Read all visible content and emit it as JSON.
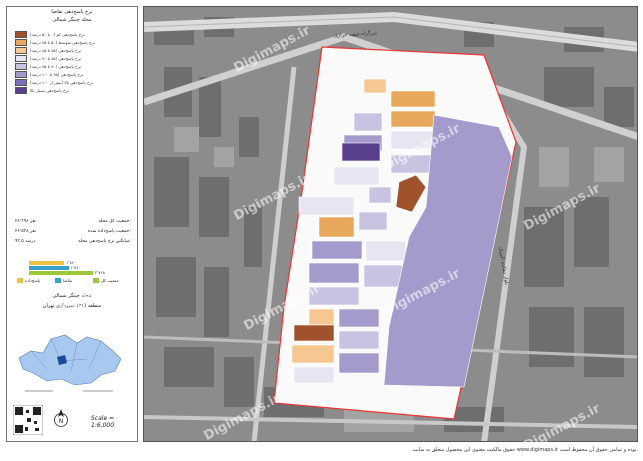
{
  "legend": {
    "title": "نرخ پاسخ‌دهی تقاضا",
    "subtitle": "محله چیتگر شمالی",
    "items": [
      {
        "label": "نرخ پاسخ‌دهی کم (۰ تا ۵۰ درصد)",
        "color": "#a0522d"
      },
      {
        "label": "نرخ پاسخ‌دهی متوسط (۵۰ تا ۷۵ درصد)",
        "color": "#e8a85c"
      },
      {
        "label": "نرخ پاسخ‌دهی (۷۵ تا ۸۵ درصد)",
        "color": "#f5c892"
      },
      {
        "label": "نرخ پاسخ‌دهی (۸۵ تا ۹۰ درصد)",
        "color": "#e8e4f2"
      },
      {
        "label": "نرخ پاسخ‌دهی (۹۰ تا ۹۵ درصد)",
        "color": "#c9c3e2"
      },
      {
        "label": "نرخ پاسخ‌دهی (۹۵ تا ۱۰۰ درصد)",
        "color": "#a49bcc"
      },
      {
        "label": "نرخ پاسخ‌دهی بالا (بیش از ۱۰۰ درصد)",
        "color": "#7c6fb5"
      },
      {
        "label": "نرخ پاسخ‌دهی بسیار بالا",
        "color": "#5b3f8f"
      }
    ]
  },
  "stats": [
    {
      "label": "جمعیت کل محله:",
      "value": "۲۸٬۳۹۸ نفر"
    },
    {
      "label": "جمعیت پاسخ‌داده شده:",
      "value": "۲۶٬۵۳۸ نفر"
    },
    {
      "label": "میانگین نرخ پاسخ‌دهی محله:",
      "value": "۹۳.۵ درصد"
    }
  ],
  "bars": {
    "values": [
      0.55,
      0.62,
      1.0
    ],
    "colors": [
      "#f0c040",
      "#3aa0c8",
      "#9ac83a"
    ],
    "labels": [
      "۱٬۸۶۰",
      "۱٬۸۶۰",
      "۲٬۷۶۸"
    ],
    "legend": [
      "پاسخ‌داده",
      "تقاضا",
      "جمعیت کل"
    ]
  },
  "inset": {
    "title1": "محله چیتگر شمالی",
    "title2": "منطقه (۲۱) شهرداری تهران"
  },
  "scale": "Scale = 1:6,000",
  "footer": "حقوق مالکیت معنوی این محصول متعلق به سایت www.digimaps.ir بوده و تمامی حقوق آن محفوظ است.",
  "watermark": "Digimaps.ir",
  "map_labels": [
    "بزرگراه شهید خرازی",
    "بلوار دهکده المپیک"
  ]
}
